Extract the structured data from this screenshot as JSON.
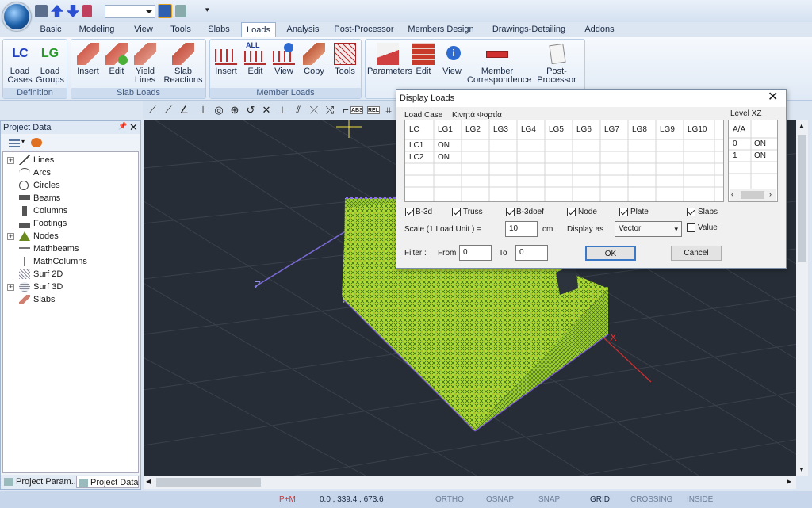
{
  "tabs": [
    "Basic",
    "Modeling",
    "View",
    "Tools",
    "Slabs",
    "Loads",
    "Analysis",
    "Post-Processor",
    "Members Design",
    "Drawings-Detailing",
    "Addons"
  ],
  "active_tab": "Loads",
  "ribbon": {
    "groups": [
      {
        "label": "Definition",
        "buttons": [
          "Load\nCases",
          "Load\nGroups"
        ]
      },
      {
        "label": "Slab Loads",
        "buttons": [
          "Insert",
          "Edit",
          "Yield\nLines",
          "Slab\nReactions"
        ]
      },
      {
        "label": "Member Loads",
        "buttons": [
          "Insert",
          "Edit",
          "View",
          "Copy",
          "Tools"
        ]
      },
      {
        "label": "",
        "buttons": [
          "Parameters",
          "Edit",
          "View",
          "Member\nCorrespondence",
          "Post-Processor"
        ]
      }
    ],
    "icon_labels": {
      "lc": "LC",
      "lg": "LG",
      "all": "ALL"
    }
  },
  "toolbar2": {
    "abs": "ABS",
    "rel": "REL"
  },
  "project_panel": {
    "title": "Project Data",
    "items": [
      {
        "label": "Lines",
        "expand": true,
        "icon": "lines-icon"
      },
      {
        "label": "Arcs",
        "expand": false,
        "icon": "arc-icon"
      },
      {
        "label": "Circles",
        "expand": false,
        "icon": "circle-icon"
      },
      {
        "label": "Beams",
        "expand": false,
        "icon": "beam-icon"
      },
      {
        "label": "Columns",
        "expand": false,
        "icon": "column-icon"
      },
      {
        "label": "Footings",
        "expand": false,
        "icon": "footing-icon"
      },
      {
        "label": "Nodes",
        "expand": true,
        "icon": "node-icon"
      },
      {
        "label": "Mathbeams",
        "expand": false,
        "icon": "mathbeam-icon"
      },
      {
        "label": "MathColumns",
        "expand": false,
        "icon": "mathcolumn-icon"
      },
      {
        "label": "Surf 2D",
        "expand": false,
        "icon": "surf2d-icon"
      },
      {
        "label": "Surf 3D",
        "expand": true,
        "icon": "surf3d-icon"
      },
      {
        "label": "Slabs",
        "expand": false,
        "icon": "slab-icon"
      }
    ],
    "tabs": [
      "Project Param...",
      "Project Data"
    ]
  },
  "viewport": {
    "axis_z": "Z",
    "axis_x": "X"
  },
  "dialog": {
    "title": "Display Loads",
    "load_case_label": "Load  Case",
    "live_loads_label": "Κινητά Φορτία",
    "level_label": "Level XZ",
    "grid_headers": [
      "LC",
      "LG1",
      "LG2",
      "LG3",
      "LG4",
      "LG5",
      "LG6",
      "LG7",
      "LG8",
      "LG9",
      "LG10"
    ],
    "grid_rows": [
      [
        "LC1",
        "ON"
      ],
      [
        "LC2",
        "ON"
      ]
    ],
    "level_headers": [
      "A/A",
      ""
    ],
    "level_rows": [
      [
        "0",
        "ON"
      ],
      [
        "1",
        "ON"
      ]
    ],
    "checkboxes": [
      {
        "label": "B-3d",
        "checked": true
      },
      {
        "label": "Truss",
        "checked": true
      },
      {
        "label": "B-3doef",
        "checked": true
      },
      {
        "label": "Node",
        "checked": true
      },
      {
        "label": "Plate",
        "checked": true
      },
      {
        "label": "Slabs",
        "checked": true
      }
    ],
    "scale_label": "Scale  (1 Load Unit ) =",
    "scale_value": "10",
    "scale_unit": "cm",
    "display_as_label": "Display as",
    "display_as_value": "Vector",
    "value_label": "Value",
    "value_checked": false,
    "filter_label": "Filter :",
    "from_label": "From",
    "from_value": "0",
    "to_label": "To",
    "to_value": "0",
    "ok_label": "OK",
    "cancel_label": "Cancel"
  },
  "status": {
    "mode": "P+M",
    "coords": "0.0 , 339.4 , 673.6",
    "toggles": [
      "ORTHO",
      "OSNAP",
      "SNAP",
      "GRID",
      "CROSSING",
      "INSIDE"
    ],
    "active_toggle": "GRID"
  },
  "colors": {
    "accent": "#d83030",
    "mesh": "#b8f030",
    "viewport_bg": "#272d36"
  }
}
